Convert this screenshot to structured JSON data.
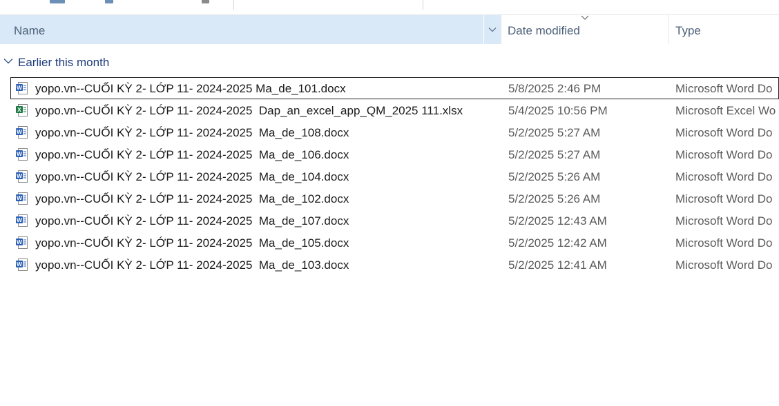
{
  "columns": {
    "name": "Name",
    "date_modified": "Date modified",
    "type": "Type"
  },
  "group": {
    "label": "Earlier this month"
  },
  "colors": {
    "header_bg": "#d9e9f8",
    "header_text": "#4c607a",
    "group_text": "#1e3d7b",
    "word_blue": "#2b5fb4",
    "excel_green": "#1d7a45"
  },
  "files": [
    {
      "name": "yopo.vn--CUỐI KỲ 2- LỚP 11- 2024-2025 Ma_de_101.docx",
      "date": "5/8/2025 2:46 PM",
      "type": "Microsoft Word Do",
      "icon": "word-doc-icon"
    },
    {
      "name": "yopo.vn--CUỐI KỲ 2- LỚP 11- 2024-2025  Dap_an_excel_app_QM_2025 111.xlsx",
      "date": "5/4/2025 10:56 PM",
      "type": "Microsoft Excel Wo",
      "icon": "excel-sheet-icon"
    },
    {
      "name": "yopo.vn--CUỐI KỲ 2- LỚP 11- 2024-2025  Ma_de_108.docx",
      "date": "5/2/2025 5:27 AM",
      "type": "Microsoft Word Do",
      "icon": "word-doc-icon"
    },
    {
      "name": "yopo.vn--CUỐI KỲ 2- LỚP 11- 2024-2025  Ma_de_106.docx",
      "date": "5/2/2025 5:27 AM",
      "type": "Microsoft Word Do",
      "icon": "word-doc-icon"
    },
    {
      "name": "yopo.vn--CUỐI KỲ 2- LỚP 11- 2024-2025  Ma_de_104.docx",
      "date": "5/2/2025 5:26 AM",
      "type": "Microsoft Word Do",
      "icon": "word-doc-icon"
    },
    {
      "name": "yopo.vn--CUỐI KỲ 2- LỚP 11- 2024-2025  Ma_de_102.docx",
      "date": "5/2/2025 5:26 AM",
      "type": "Microsoft Word Do",
      "icon": "word-doc-icon"
    },
    {
      "name": "yopo.vn--CUỐI KỲ 2- LỚP 11- 2024-2025  Ma_de_107.docx",
      "date": "5/2/2025 12:43 AM",
      "type": "Microsoft Word Do",
      "icon": "word-doc-icon"
    },
    {
      "name": "yopo.vn--CUỐI KỲ 2- LỚP 11- 2024-2025  Ma_de_105.docx",
      "date": "5/2/2025 12:42 AM",
      "type": "Microsoft Word Do",
      "icon": "word-doc-icon"
    },
    {
      "name": "yopo.vn--CUỐI KỲ 2- LỚP 11- 2024-2025  Ma_de_103.docx",
      "date": "5/2/2025 12:41 AM",
      "type": "Microsoft Word Do",
      "icon": "word-doc-icon"
    }
  ]
}
